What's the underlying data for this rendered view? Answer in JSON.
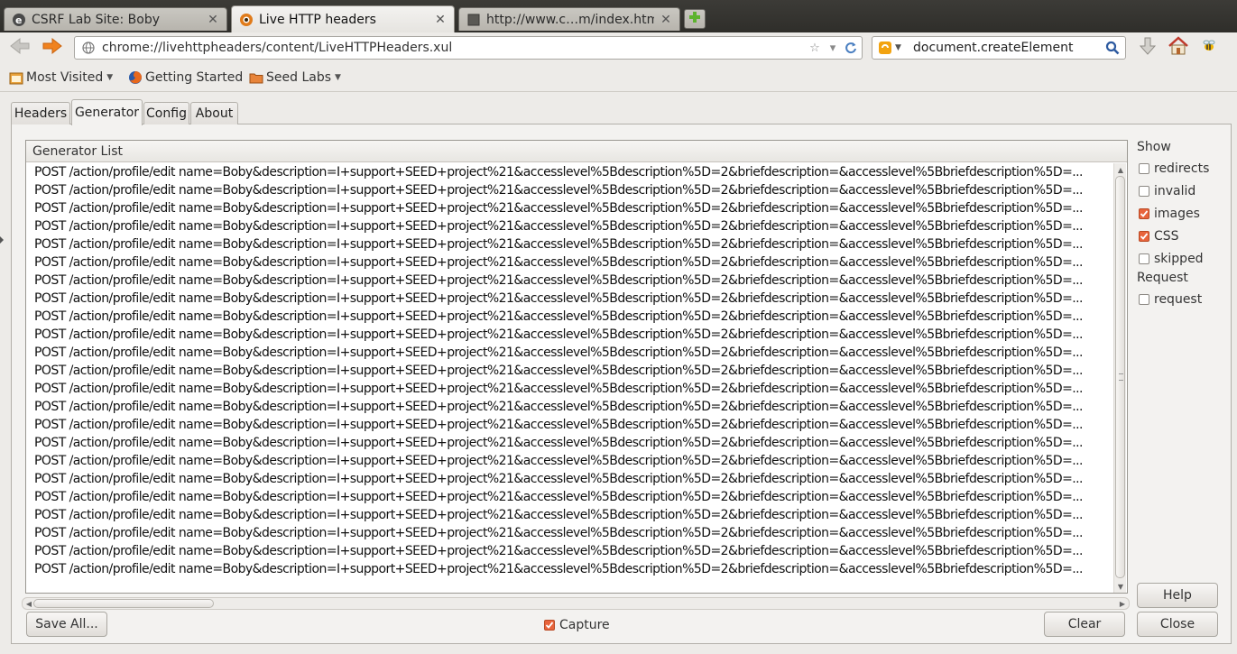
{
  "browser": {
    "tabs": [
      {
        "title": "CSRF Lab Site: Boby",
        "icon": "elgg-e-icon",
        "active": false
      },
      {
        "title": "Live HTTP headers",
        "icon": "live-http-headers-icon",
        "active": true
      },
      {
        "title": "http://www.c…m/index.html",
        "icon": "blank-page-icon",
        "active": false
      }
    ],
    "new_tab_icon": "plus-icon",
    "url": "chrome://livehttpheaders/content/LiveHTTPHeaders.xul",
    "search_text": "document.createElement",
    "bookmarks": [
      {
        "label": "Most Visited",
        "icon": "most-visited-icon",
        "dropdown": true
      },
      {
        "label": "Getting Started",
        "icon": "firefox-icon",
        "dropdown": false
      },
      {
        "label": "Seed Labs",
        "icon": "folder-icon",
        "dropdown": true
      }
    ]
  },
  "dialog": {
    "tabs": [
      "Headers",
      "Generator",
      "Config",
      "About"
    ],
    "selected_tab": "Generator",
    "list_header": "Generator List",
    "rows": [
      "POST /action/profile/edit name=Boby&description=I+support+SEED+project%21&accesslevel%5Bdescription%5D=2&briefdescription=&accesslevel%5Bbriefdescription%5D=...",
      "POST /action/profile/edit name=Boby&description=I+support+SEED+project%21&accesslevel%5Bdescription%5D=2&briefdescription=&accesslevel%5Bbriefdescription%5D=...",
      "POST /action/profile/edit name=Boby&description=I+support+SEED+project%21&accesslevel%5Bdescription%5D=2&briefdescription=&accesslevel%5Bbriefdescription%5D=...",
      "POST /action/profile/edit name=Boby&description=I+support+SEED+project%21&accesslevel%5Bdescription%5D=2&briefdescription=&accesslevel%5Bbriefdescription%5D=...",
      "POST /action/profile/edit name=Boby&description=I+support+SEED+project%21&accesslevel%5Bdescription%5D=2&briefdescription=&accesslevel%5Bbriefdescription%5D=...",
      "POST /action/profile/edit name=Boby&description=I+support+SEED+project%21&accesslevel%5Bdescription%5D=2&briefdescription=&accesslevel%5Bbriefdescription%5D=...",
      "POST /action/profile/edit name=Boby&description=I+support+SEED+project%21&accesslevel%5Bdescription%5D=2&briefdescription=&accesslevel%5Bbriefdescription%5D=...",
      "POST /action/profile/edit name=Boby&description=I+support+SEED+project%21&accesslevel%5Bdescription%5D=2&briefdescription=&accesslevel%5Bbriefdescription%5D=...",
      "POST /action/profile/edit name=Boby&description=I+support+SEED+project%21&accesslevel%5Bdescription%5D=2&briefdescription=&accesslevel%5Bbriefdescription%5D=...",
      "POST /action/profile/edit name=Boby&description=I+support+SEED+project%21&accesslevel%5Bdescription%5D=2&briefdescription=&accesslevel%5Bbriefdescription%5D=...",
      "POST /action/profile/edit name=Boby&description=I+support+SEED+project%21&accesslevel%5Bdescription%5D=2&briefdescription=&accesslevel%5Bbriefdescription%5D=...",
      "POST /action/profile/edit name=Boby&description=I+support+SEED+project%21&accesslevel%5Bdescription%5D=2&briefdescription=&accesslevel%5Bbriefdescription%5D=...",
      "POST /action/profile/edit name=Boby&description=I+support+SEED+project%21&accesslevel%5Bdescription%5D=2&briefdescription=&accesslevel%5Bbriefdescription%5D=...",
      "POST /action/profile/edit name=Boby&description=I+support+SEED+project%21&accesslevel%5Bdescription%5D=2&briefdescription=&accesslevel%5Bbriefdescription%5D=...",
      "POST /action/profile/edit name=Boby&description=I+support+SEED+project%21&accesslevel%5Bdescription%5D=2&briefdescription=&accesslevel%5Bbriefdescription%5D=...",
      "POST /action/profile/edit name=Boby&description=I+support+SEED+project%21&accesslevel%5Bdescription%5D=2&briefdescription=&accesslevel%5Bbriefdescription%5D=...",
      "POST /action/profile/edit name=Boby&description=I+support+SEED+project%21&accesslevel%5Bdescription%5D=2&briefdescription=&accesslevel%5Bbriefdescription%5D=...",
      "POST /action/profile/edit name=Boby&description=I+support+SEED+project%21&accesslevel%5Bdescription%5D=2&briefdescription=&accesslevel%5Bbriefdescription%5D=...",
      "POST /action/profile/edit name=Boby&description=I+support+SEED+project%21&accesslevel%5Bdescription%5D=2&briefdescription=&accesslevel%5Bbriefdescription%5D=...",
      "POST /action/profile/edit name=Boby&description=I+support+SEED+project%21&accesslevel%5Bdescription%5D=2&briefdescription=&accesslevel%5Bbriefdescription%5D=...",
      "POST /action/profile/edit name=Boby&description=I+support+SEED+project%21&accesslevel%5Bdescription%5D=2&briefdescription=&accesslevel%5Bbriefdescription%5D=...",
      "POST /action/profile/edit name=Boby&description=I+support+SEED+project%21&accesslevel%5Bdescription%5D=2&briefdescription=&accesslevel%5Bbriefdescription%5D=...",
      "POST /action/profile/edit name=Boby&description=I+support+SEED+project%21&accesslevel%5Bdescription%5D=2&briefdescription=&accesslevel%5Bbriefdescription%5D=..."
    ],
    "show": {
      "title": "Show",
      "options": [
        {
          "label": "redirects",
          "checked": false
        },
        {
          "label": "invalid",
          "checked": false
        },
        {
          "label": "images",
          "checked": true
        },
        {
          "label": "CSS",
          "checked": true
        },
        {
          "label": "skipped",
          "checked": false
        }
      ]
    },
    "request": {
      "title": "Request",
      "options": [
        {
          "label": "request",
          "checked": false
        }
      ]
    },
    "buttons": {
      "help": "Help",
      "save_all": "Save All...",
      "clear": "Clear",
      "close": "Close"
    },
    "capture": {
      "label": "Capture",
      "checked": true
    }
  },
  "colors": {
    "accent_check": "#e8643c",
    "tabstrip_bg": "#3c3b37",
    "window_bg": "#edebe8"
  }
}
